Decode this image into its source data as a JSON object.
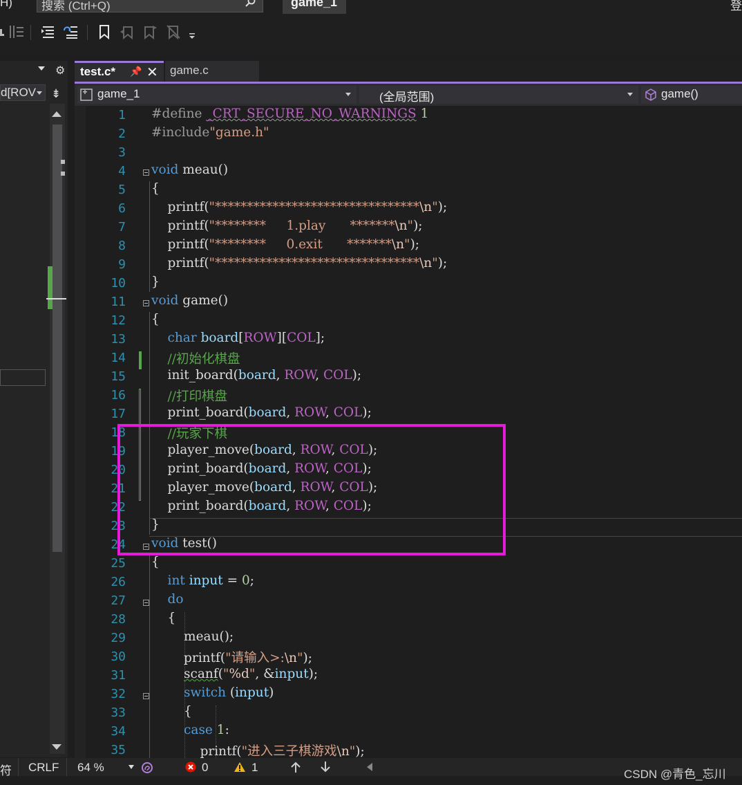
{
  "titlebar": {
    "menu_fragment": "H)",
    "search_placeholder": "搜索 (Ctrl+Q)",
    "project_title": "game_1",
    "corner_text": "登"
  },
  "left_panel": {
    "combo_text": "d[ROV"
  },
  "tabs": [
    {
      "label": "test.c*",
      "active": true
    },
    {
      "label": "game.c",
      "active": false
    }
  ],
  "navbar": {
    "project": "game_1",
    "scope": "(全局范围)",
    "member": "game()"
  },
  "editor": {
    "line_numbers": [
      "1",
      "2",
      "3",
      "4",
      "5",
      "6",
      "7",
      "8",
      "9",
      "10",
      "11",
      "12",
      "13",
      "14",
      "15",
      "16",
      "17",
      "18",
      "19",
      "20",
      "21",
      "22",
      "23",
      "24",
      "25",
      "26",
      "27",
      "28",
      "29",
      "30",
      "31",
      "32",
      "33",
      "34",
      "35"
    ],
    "lines": [
      "#define _CRT_SECURE_NO_WARNINGS 1",
      "#include\"game.h\"",
      "",
      "void meau()",
      "{",
      "    printf(\"********************************\\n\");",
      "    printf(\"********     1.play      *******\\n\");",
      "    printf(\"********     0.exit      *******\\n\");",
      "    printf(\"********************************\\n\");",
      "}",
      "void game()",
      "{",
      "    char board[ROW][COL];",
      "    //初始化棋盘",
      "    init_board(board, ROW, COL);",
      "    //打印棋盘",
      "    print_board(board, ROW, COL);",
      "    //玩家下棋",
      "    player_move(board, ROW, COL);",
      "    print_board(board, ROW, COL);",
      "    player_move(board, ROW, COL);",
      "    print_board(board, ROW, COL);",
      "}",
      "void test()",
      "{",
      "    int input = 0;",
      "    do",
      "    {",
      "        meau();",
      "        printf(\"请输入>:\\n\");",
      "        scanf(\"%d\", &input);",
      "        switch (input)",
      "        {",
      "        case 1:",
      "            printf(\"进入三子棋游戏\\n\");"
    ]
  },
  "statusbar": {
    "encoding_fragment": "符",
    "line_ending": "CRLF",
    "zoom": "64 %",
    "errors": "0",
    "warnings": "1"
  },
  "watermark": "CSDN @青色_忘川",
  "colors": {
    "accent": "#9a7ad6",
    "highlight_box": "#e61bd9",
    "change_marker": "#57a64a",
    "line_number": "#2b91af"
  }
}
